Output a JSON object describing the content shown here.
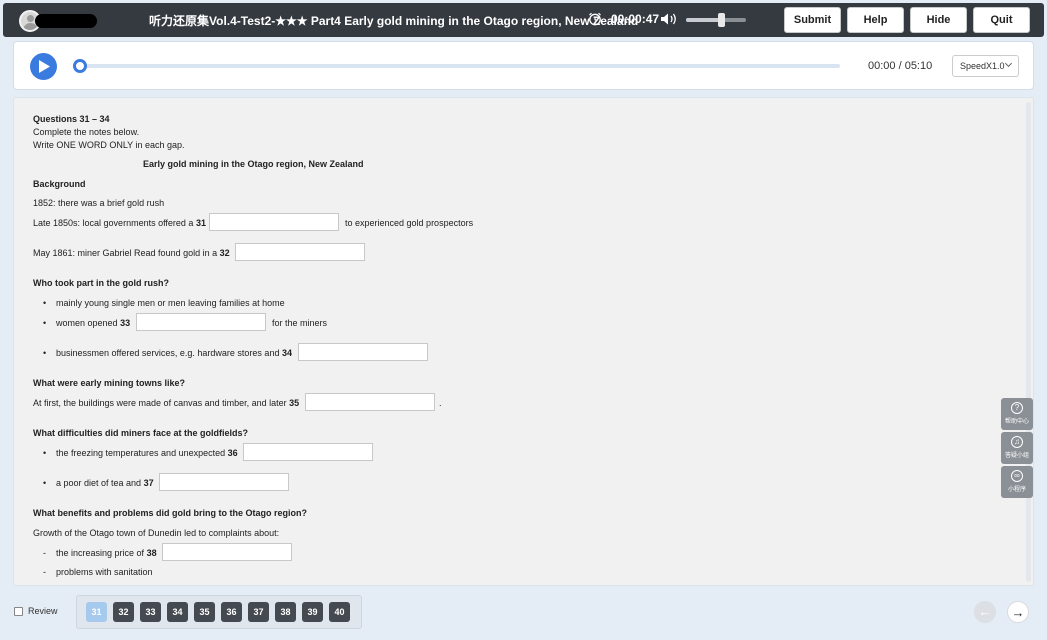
{
  "header": {
    "title": "听力还原集Vol.4-Test2-★★★ Part4 Early gold mining in the Otago region, New Zealand",
    "timer": "00:00:47",
    "volume_level": 0.55,
    "buttons": [
      "Submit",
      "Help",
      "Hide",
      "Quit"
    ]
  },
  "audio": {
    "time": "00:00 / 05:10",
    "progress": 0.0,
    "speed": "SpeedX1.0"
  },
  "section": {
    "heading": "Questions 31 – 34",
    "instr1": "Complete the notes below.",
    "instr2": "Write ONE WORD ONLY in each gap.",
    "notes_title": "Early gold mining in the Otago region, New Zealand",
    "h_background": "Background",
    "l_1852": "1852: there was a brief gold rush",
    "l_1850s_a": "Late 1850s: local governments offered a",
    "l_1850s_b": "to experienced gold prospectors",
    "l_1861": "May 1861: miner Gabriel Read found gold in a",
    "h_who": "Who took part in the gold rush?",
    "b_young": "mainly young single men or men leaving families at home",
    "b_women_a": "women opened",
    "b_women_b": "for the miners",
    "b_business": "businessmen offered services, e.g. hardware stores and",
    "h_towns": "What were early mining towns like?",
    "l_towns": "At first, the buildings were made of canvas and timber, and later",
    "l_towns_end": ".",
    "h_difficulties": "What difficulties did miners face at the goldfields?",
    "b_freezing": "the freezing temperatures and unexpected",
    "b_diet": "a poor diet of tea and",
    "h_benefits": "What benefits and problems did gold bring to the Otago region?",
    "l_dunedin": "Growth of the Otago town of Dunedin led to complaints about:",
    "b_price": "the increasing price of",
    "b_sanitation": "problems with sanitation",
    "bullet": "•",
    "dash": "-"
  },
  "gaps": {
    "n31": "31",
    "n32": "32",
    "n33": "33",
    "n34": "34",
    "n35": "35",
    "n36": "36",
    "n37": "37",
    "n38": "38",
    "v31": "",
    "v32": "",
    "v33": "",
    "v34": "",
    "v35": "",
    "v36": "",
    "v37": "",
    "v38": ""
  },
  "sidetools": [
    "帮助中心",
    "答疑小组",
    "小程序"
  ],
  "footer": {
    "review_label": "Review",
    "review_checked": false,
    "questions": [
      "31",
      "32",
      "33",
      "34",
      "35",
      "36",
      "37",
      "38",
      "39",
      "40"
    ],
    "active_question": "31",
    "prev_icon": "arrow-left-icon",
    "next_icon": "arrow-right-icon"
  },
  "colors": {
    "header_bg": "#353a40",
    "accent": "#3a7be0",
    "active_question": "#a6c9ee",
    "question_button": "#454a50"
  }
}
